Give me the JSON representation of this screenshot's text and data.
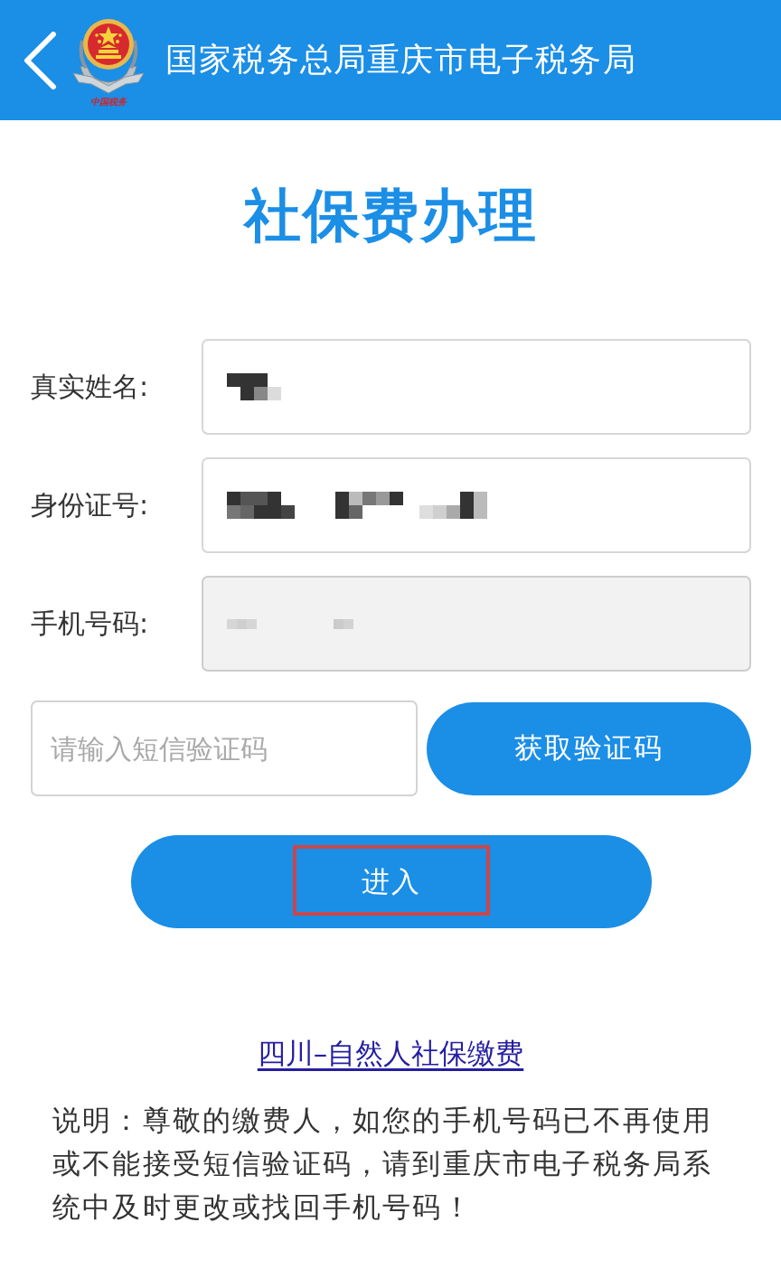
{
  "header": {
    "title": "国家税务总局重庆市电子税务局",
    "logo_caption": "中国税务"
  },
  "page_title": "社保费办理",
  "form": {
    "fields": [
      {
        "label": "真实姓名:",
        "redacted": true,
        "disabled": false
      },
      {
        "label": "身份证号:",
        "redacted": true,
        "disabled": false
      },
      {
        "label": "手机号码:",
        "redacted": true,
        "disabled": true
      }
    ],
    "sms_code": {
      "placeholder": "请输入短信验证码"
    },
    "get_code_button": "获取验证码",
    "enter_button": {
      "label": "进入",
      "highlighted": true
    }
  },
  "link": "四川–自然人社保缴费",
  "notice": "说明：尊敬的缴费人，如您的手机号码已不再使用或不能接受短信验证码，请到重庆市电子税务局系统中及时更改或找回手机号码！"
}
